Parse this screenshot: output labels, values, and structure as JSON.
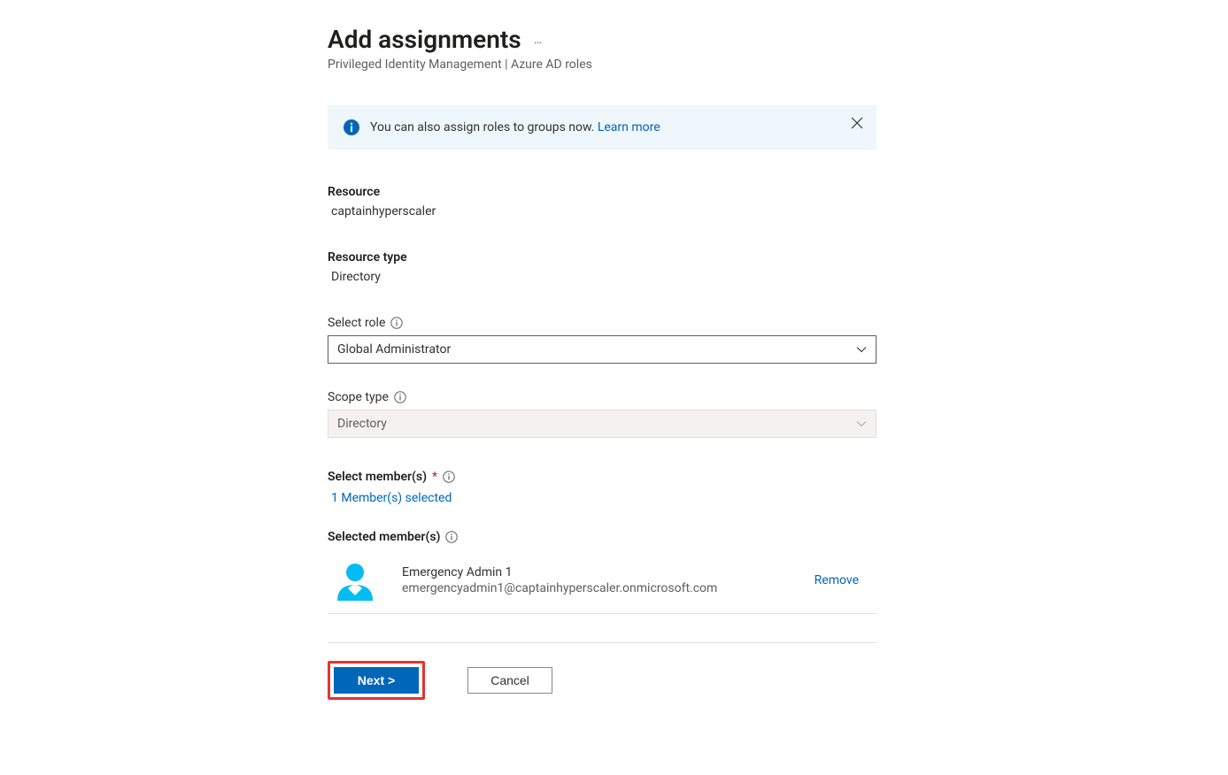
{
  "header": {
    "title": "Add assignments",
    "ellipsis": "…",
    "subtitle": "Privileged Identity Management | Azure AD roles"
  },
  "banner": {
    "text": "You can also assign roles to groups now. ",
    "link": "Learn more"
  },
  "form": {
    "resource": {
      "label": "Resource",
      "value": "captainhyperscaler"
    },
    "resource_type": {
      "label": "Resource type",
      "value": "Directory"
    },
    "select_role": {
      "label": "Select role",
      "value": "Global Administrator"
    },
    "scope_type": {
      "label": "Scope type",
      "value": "Directory"
    },
    "select_members": {
      "label": "Select member(s)",
      "selected_text": "1 Member(s) selected"
    },
    "selected_members": {
      "label": "Selected member(s)",
      "items": [
        {
          "name": "Emergency Admin 1",
          "email": "emergencyadmin1@captainhyperscaler.onmicrosoft.com",
          "remove": "Remove"
        }
      ]
    }
  },
  "footer": {
    "next": "Next >",
    "cancel": "Cancel"
  }
}
